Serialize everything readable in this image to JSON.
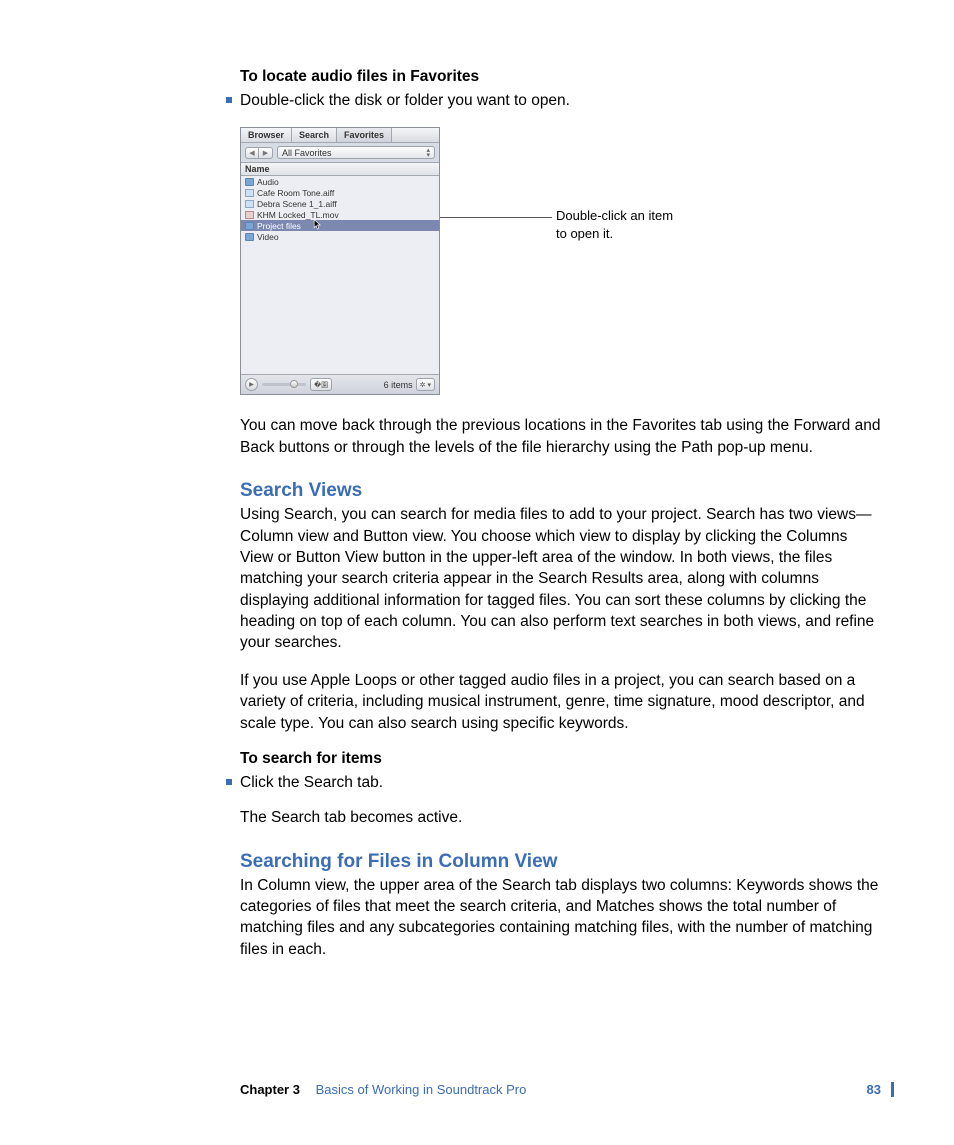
{
  "section1": {
    "heading": "To locate audio files in Favorites",
    "bullet": "Double-click the disk or folder you want to open."
  },
  "panel": {
    "tabs": [
      "Browser",
      "Search",
      "Favorites"
    ],
    "activeTabIndex": 2,
    "pathLabel": "All Favorites",
    "columnHeader": "Name",
    "rows": [
      {
        "icon": "folder",
        "label": "Audio"
      },
      {
        "icon": "audio",
        "label": "Cafe Room Tone.aiff"
      },
      {
        "icon": "audio",
        "label": "Debra Scene 1_1.aiff"
      },
      {
        "icon": "video",
        "label": "KHM Locked_TL.mov"
      },
      {
        "icon": "folder",
        "label": "Project files",
        "selected": true
      },
      {
        "icon": "folder",
        "label": "Video"
      }
    ],
    "itemCount": "6 items"
  },
  "callout": {
    "line1": "Double-click an item",
    "line2": "to open it."
  },
  "para_after_figure": "You can move back through the previous locations in the Favorites tab using the Forward and Back buttons or through the levels of the file hierarchy using the Path pop-up menu.",
  "section2": {
    "title": "Search Views",
    "p1": "Using Search, you can search for media files to add to your project. Search has two views—Column view and Button view. You choose which view to display by clicking the Columns View or Button View button in the upper-left area of the window. In both views, the files matching your search criteria appear in the Search Results area, along with columns displaying additional information for tagged files. You can sort these columns by clicking the heading on top of each column. You can also perform text searches in both views, and refine your searches.",
    "p2": "If you use Apple Loops or other tagged audio files in a project, you can search based on a variety of criteria, including musical instrument, genre, time signature, mood descriptor, and scale type. You can also search using specific keywords."
  },
  "section3": {
    "heading": "To search for items",
    "bullet": "Click the Search tab.",
    "followup": "The Search tab becomes active."
  },
  "section4": {
    "title": "Searching for Files in Column View",
    "p1": "In Column view, the upper area of the Search tab displays two columns: Keywords shows the categories of files that meet the search criteria, and Matches shows the total number of matching files and any subcategories containing matching files, with the number of matching files in each."
  },
  "footer": {
    "chapter": "Chapter 3",
    "title": "Basics of Working in Soundtrack Pro",
    "page": "83"
  }
}
